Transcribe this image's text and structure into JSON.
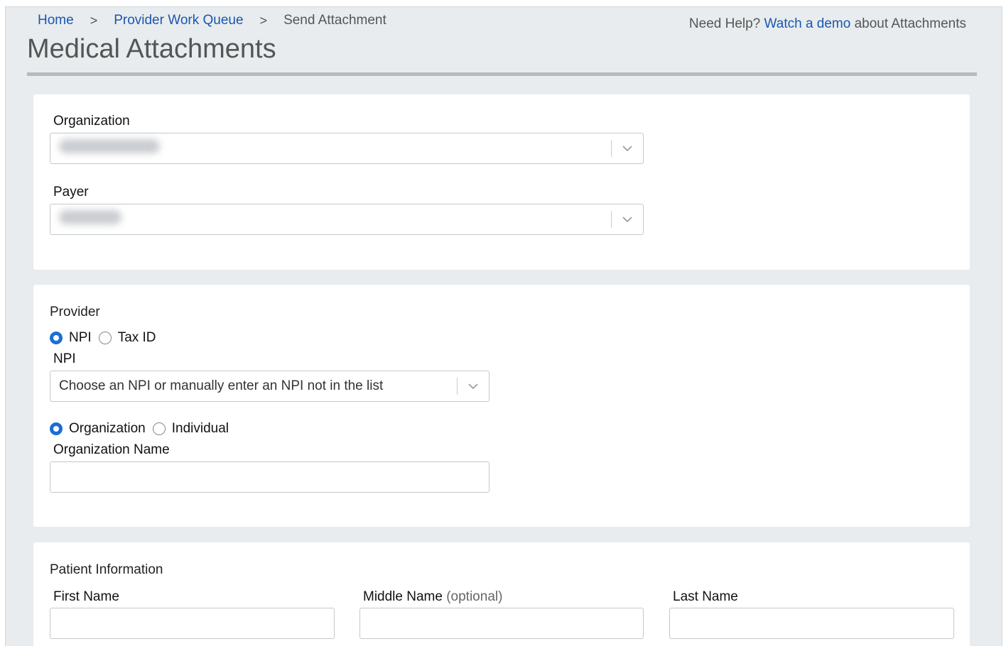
{
  "breadcrumb": {
    "items": [
      "Home",
      "Provider Work Queue"
    ],
    "current": "Send Attachment",
    "separator": ">"
  },
  "help": {
    "prefix": "Need Help?",
    "link": "Watch a demo",
    "suffix": "about Attachments"
  },
  "page_title": "Medical Attachments",
  "org_payer": {
    "organization_label": "Organization",
    "payer_label": "Payer"
  },
  "provider": {
    "title": "Provider",
    "id_type_options": [
      "NPI",
      "Tax ID"
    ],
    "id_type_selected": "NPI",
    "npi_label": "NPI",
    "npi_placeholder": "Choose an NPI or manually enter an NPI not in the list",
    "entity_options": [
      "Organization",
      "Individual"
    ],
    "entity_selected": "Organization",
    "org_name_label": "Organization Name",
    "org_name_value": ""
  },
  "patient": {
    "title": "Patient Information",
    "first_name_label": "First Name",
    "middle_name_label": "Middle Name",
    "middle_name_hint": "(optional)",
    "last_name_label": "Last Name"
  },
  "colors": {
    "link": "#1a56b0",
    "radio_selected": "#1a6fd6",
    "frame_bg": "#e8ecee"
  }
}
